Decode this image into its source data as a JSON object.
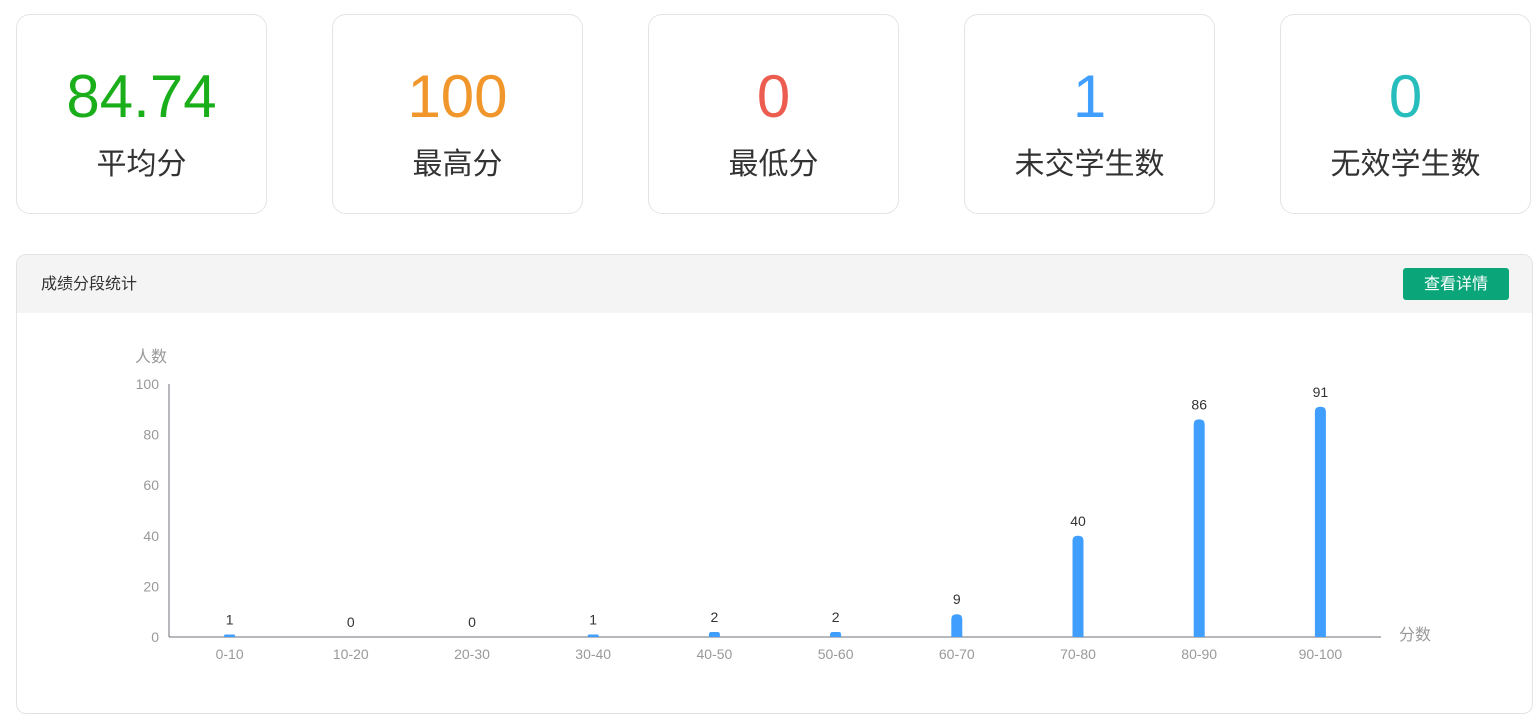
{
  "stats": [
    {
      "value": "84.74",
      "label": "平均分",
      "color": "#1aaf1a"
    },
    {
      "value": "100",
      "label": "最高分",
      "color": "#f0962b"
    },
    {
      "value": "0",
      "label": "最低分",
      "color": "#ed5d4f"
    },
    {
      "value": "1",
      "label": "未交学生数",
      "color": "#409eff"
    },
    {
      "value": "0",
      "label": "无效学生数",
      "color": "#27bdbd"
    }
  ],
  "panel": {
    "title": "成绩分段统计",
    "detail_button": "查看详情"
  },
  "chart_data": {
    "type": "bar",
    "categories": [
      "0-10",
      "10-20",
      "20-30",
      "30-40",
      "40-50",
      "50-60",
      "60-70",
      "70-80",
      "80-90",
      "90-100"
    ],
    "values": [
      1,
      0,
      0,
      1,
      2,
      2,
      9,
      40,
      86,
      91
    ],
    "xlabel": "分数",
    "ylabel": "人数",
    "ylim": [
      0,
      100
    ],
    "yticks": [
      0,
      20,
      40,
      60,
      80,
      100
    ],
    "bar_color": "#409eff",
    "data_labels": true,
    "grid": false,
    "legend": "none"
  }
}
